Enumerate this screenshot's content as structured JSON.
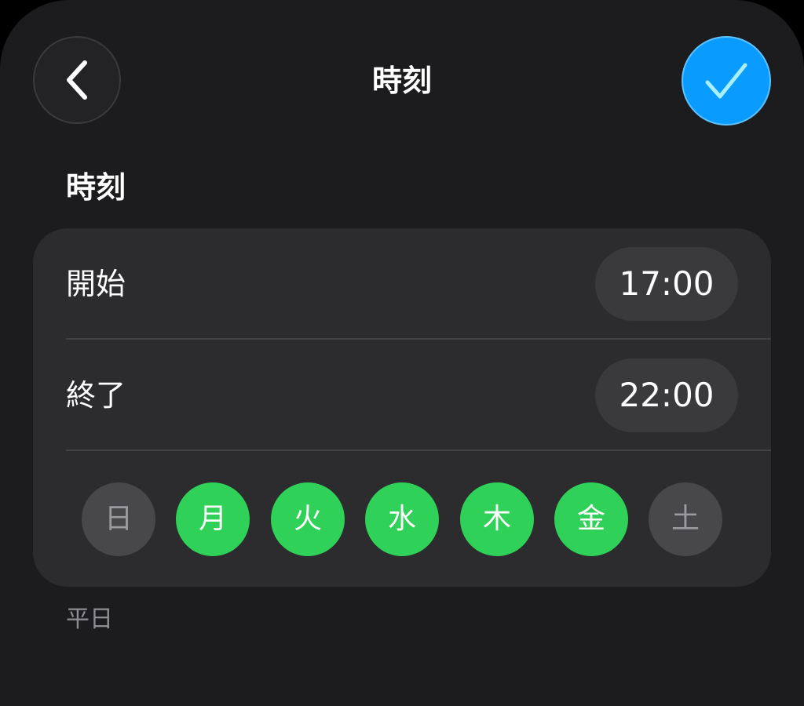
{
  "header": {
    "title": "時刻",
    "back_icon": "chevron-left-icon",
    "confirm_icon": "checkmark-icon",
    "confirm_color": "#0a9bff"
  },
  "section": {
    "heading": "時刻"
  },
  "schedule": {
    "start": {
      "label": "開始",
      "time": "17:00"
    },
    "end": {
      "label": "終了",
      "time": "22:00"
    }
  },
  "days": [
    {
      "label": "日",
      "selected": false
    },
    {
      "label": "月",
      "selected": true
    },
    {
      "label": "火",
      "selected": true
    },
    {
      "label": "水",
      "selected": true
    },
    {
      "label": "木",
      "selected": true
    },
    {
      "label": "金",
      "selected": true
    },
    {
      "label": "土",
      "selected": false
    }
  ],
  "colors": {
    "selected_day": "#30d158",
    "unselected_day": "#48484a"
  },
  "footnote": "平日"
}
